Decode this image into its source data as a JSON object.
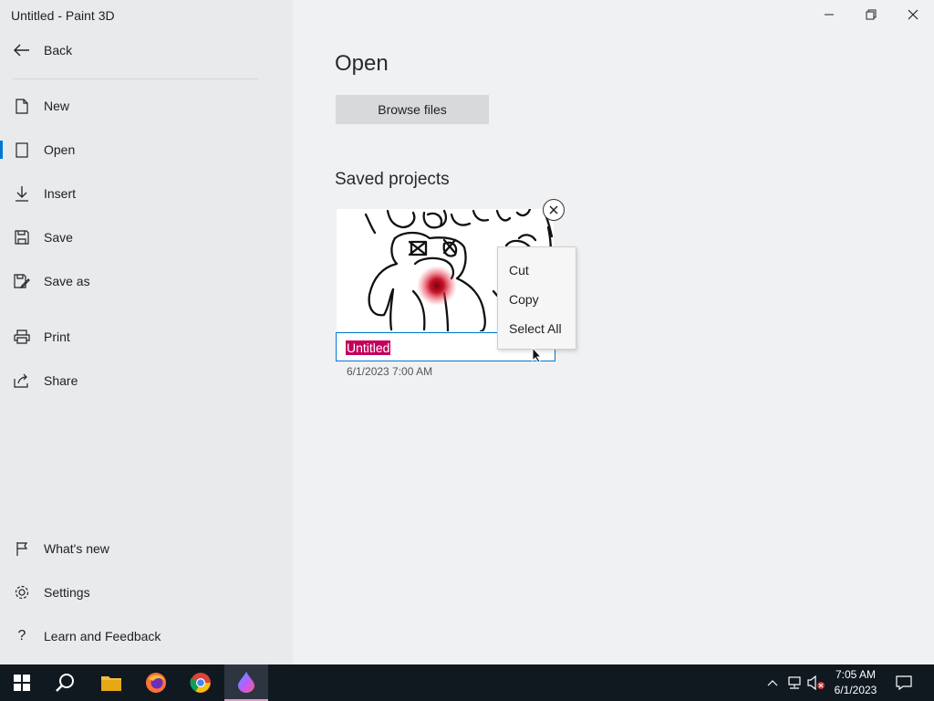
{
  "window": {
    "title": "Untitled - Paint 3D"
  },
  "sidebar": {
    "back_label": "Back",
    "items": [
      {
        "label": "New",
        "icon": "new-file-icon"
      },
      {
        "label": "Open",
        "icon": "open-icon"
      },
      {
        "label": "Insert",
        "icon": "insert-icon"
      },
      {
        "label": "Save",
        "icon": "save-icon"
      },
      {
        "label": "Save as",
        "icon": "save-as-icon"
      },
      {
        "label": "Print",
        "icon": "print-icon"
      },
      {
        "label": "Share",
        "icon": "share-icon"
      }
    ],
    "bottom_items": [
      {
        "label": "What's new",
        "icon": "flag-icon"
      },
      {
        "label": "Settings",
        "icon": "gear-icon"
      },
      {
        "label": "Learn and Feedback",
        "icon": "question-icon"
      }
    ]
  },
  "main": {
    "title": "Open",
    "browse_label": "Browse files",
    "saved_title": "Saved projects",
    "project": {
      "name": "Untitled",
      "date": "6/1/2023 7:00 AM"
    }
  },
  "context_menu": {
    "items": [
      "Cut",
      "Copy",
      "Select All"
    ]
  },
  "taskbar": {
    "time": "7:05 AM",
    "date": "6/1/2023"
  },
  "colors": {
    "accent": "#0078d4",
    "selection": "#c3005a",
    "taskbar": "#101820"
  }
}
